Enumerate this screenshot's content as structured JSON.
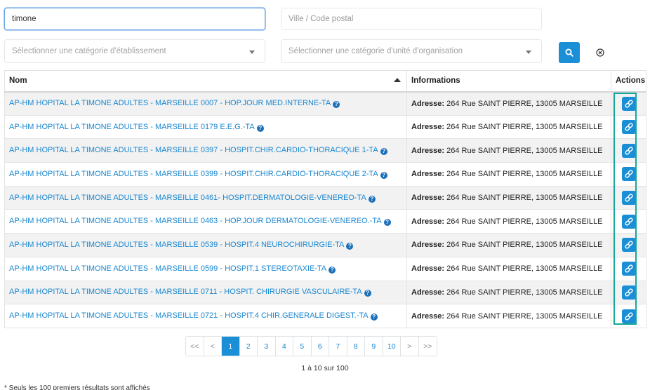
{
  "search": {
    "query_value": "timone",
    "city_placeholder": "Ville / Code postal",
    "category_placeholder": "Sélectionner une catégorie d'établissement",
    "unit_placeholder": "Sélectionner une catégorie d'unité d'organisation"
  },
  "table": {
    "headers": {
      "name": "Nom",
      "info": "Informations",
      "actions": "Actions"
    },
    "address_label": "Adresse:",
    "rows": [
      {
        "name": "AP-HM HOPITAL LA TIMONE ADULTES - MARSEILLE 0007 - HOP.JOUR MED.INTERNE-TA",
        "address": "264 Rue SAINT PIERRE, 13005 MARSEILLE"
      },
      {
        "name": "AP-HM HOPITAL LA TIMONE ADULTES - MARSEILLE 0179 E.E.G.-TA",
        "address": "264 Rue SAINT PIERRE, 13005 MARSEILLE"
      },
      {
        "name": "AP-HM HOPITAL LA TIMONE ADULTES - MARSEILLE 0397 - HOSPIT.CHIR.CARDIO-THORACIQUE 1-TA",
        "address": "264 Rue SAINT PIERRE, 13005 MARSEILLE"
      },
      {
        "name": "AP-HM HOPITAL LA TIMONE ADULTES - MARSEILLE 0399 - HOSPIT.CHIR.CARDIO-THORACIQUE 2-TA",
        "address": "264 Rue SAINT PIERRE, 13005 MARSEILLE"
      },
      {
        "name": "AP-HM HOPITAL LA TIMONE ADULTES - MARSEILLE 0461- HOSPIT.DERMATOLOGIE-VENEREO-TA",
        "address": "264 Rue SAINT PIERRE, 13005 MARSEILLE"
      },
      {
        "name": "AP-HM HOPITAL LA TIMONE ADULTES - MARSEILLE 0463 - HOP.JOUR DERMATOLOGIE-VENEREO.-TA",
        "address": "264 Rue SAINT PIERRE, 13005 MARSEILLE"
      },
      {
        "name": "AP-HM HOPITAL LA TIMONE ADULTES - MARSEILLE 0539 - HOSPIT.4 NEUROCHIRURGIE-TA",
        "address": "264 Rue SAINT PIERRE, 13005 MARSEILLE"
      },
      {
        "name": "AP-HM HOPITAL LA TIMONE ADULTES - MARSEILLE 0599 - HOSPIT.1 STEREOTAXIE-TA",
        "address": "264 Rue SAINT PIERRE, 13005 MARSEILLE"
      },
      {
        "name": "AP-HM HOPITAL LA TIMONE ADULTES - MARSEILLE 0711 - HOSPIT. CHIRURGIE VASCULAIRE-TA",
        "address": "264 Rue SAINT PIERRE, 13005 MARSEILLE"
      },
      {
        "name": "AP-HM HOPITAL LA TIMONE ADULTES - MARSEILLE 0721 - HOSPIT.4 CHIR.GENERALE DIGEST.-TA",
        "address": "264 Rue SAINT PIERRE, 13005 MARSEILLE"
      }
    ]
  },
  "pagination": {
    "first": "<<",
    "prev": "<",
    "pages": [
      "1",
      "2",
      "3",
      "4",
      "5",
      "6",
      "7",
      "8",
      "9",
      "10"
    ],
    "active_page": "1",
    "next": ">",
    "last": ">>"
  },
  "result_count": "1 à 10 sur 100",
  "footnote": "* Seuls les 100 premiers résultats sont affichés",
  "colors": {
    "accent": "#1a8fd6",
    "link": "#1a87d0",
    "highlight_outline": "#15a79a"
  }
}
